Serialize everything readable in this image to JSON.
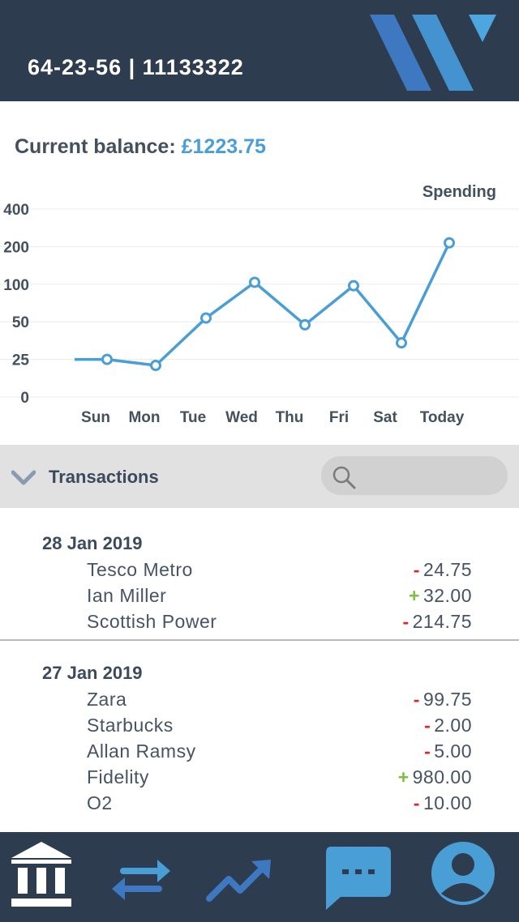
{
  "header": {
    "account": "64-23-56 | 11133322"
  },
  "balance": {
    "label": "Current balance:",
    "amount": "£1223.75"
  },
  "chart_data": {
    "type": "line",
    "title": "Spending",
    "categories": [
      "",
      "Sun",
      "Mon",
      "Tue",
      "Wed",
      "Thu",
      "Fri",
      "Sat",
      "Today"
    ],
    "y_ticks": [
      "0",
      "25",
      "50",
      "100",
      "200",
      "400"
    ],
    "series": [
      {
        "values": [
          25,
          25,
          21,
          55,
          105,
          48,
          98,
          36,
          220
        ]
      }
    ],
    "grid": true,
    "color": "#4a9ed6"
  },
  "transactions": {
    "title": "Transactions",
    "search_placeholder": "",
    "groups": [
      {
        "date": "28 Jan 2019",
        "items": [
          {
            "name": "Tesco Metro",
            "sign": "-",
            "amount": "24.75"
          },
          {
            "name": "Ian Miller",
            "sign": "+",
            "amount": "32.00"
          },
          {
            "name": "Scottish Power",
            "sign": "-",
            "amount": "214.75"
          }
        ]
      },
      {
        "date": "27 Jan 2019",
        "items": [
          {
            "name": "Zara",
            "sign": "-",
            "amount": "99.75"
          },
          {
            "name": "Starbucks",
            "sign": "-",
            "amount": "2.00"
          },
          {
            "name": "Allan Ramsy",
            "sign": "-",
            "amount": "5.00"
          },
          {
            "name": "Fidelity",
            "sign": "+",
            "amount": "980.00"
          },
          {
            "name": "O2",
            "sign": "-",
            "amount": "10.00"
          }
        ]
      }
    ]
  },
  "footer": {
    "icons": [
      "bank-icon",
      "transfer-icon",
      "trend-icon",
      "chat-icon",
      "profile-icon"
    ]
  },
  "colors": {
    "header_bg": "#2e3c50",
    "accent": "#4a9ed6",
    "minus": "#e0242c",
    "plus": "#7ac142"
  }
}
